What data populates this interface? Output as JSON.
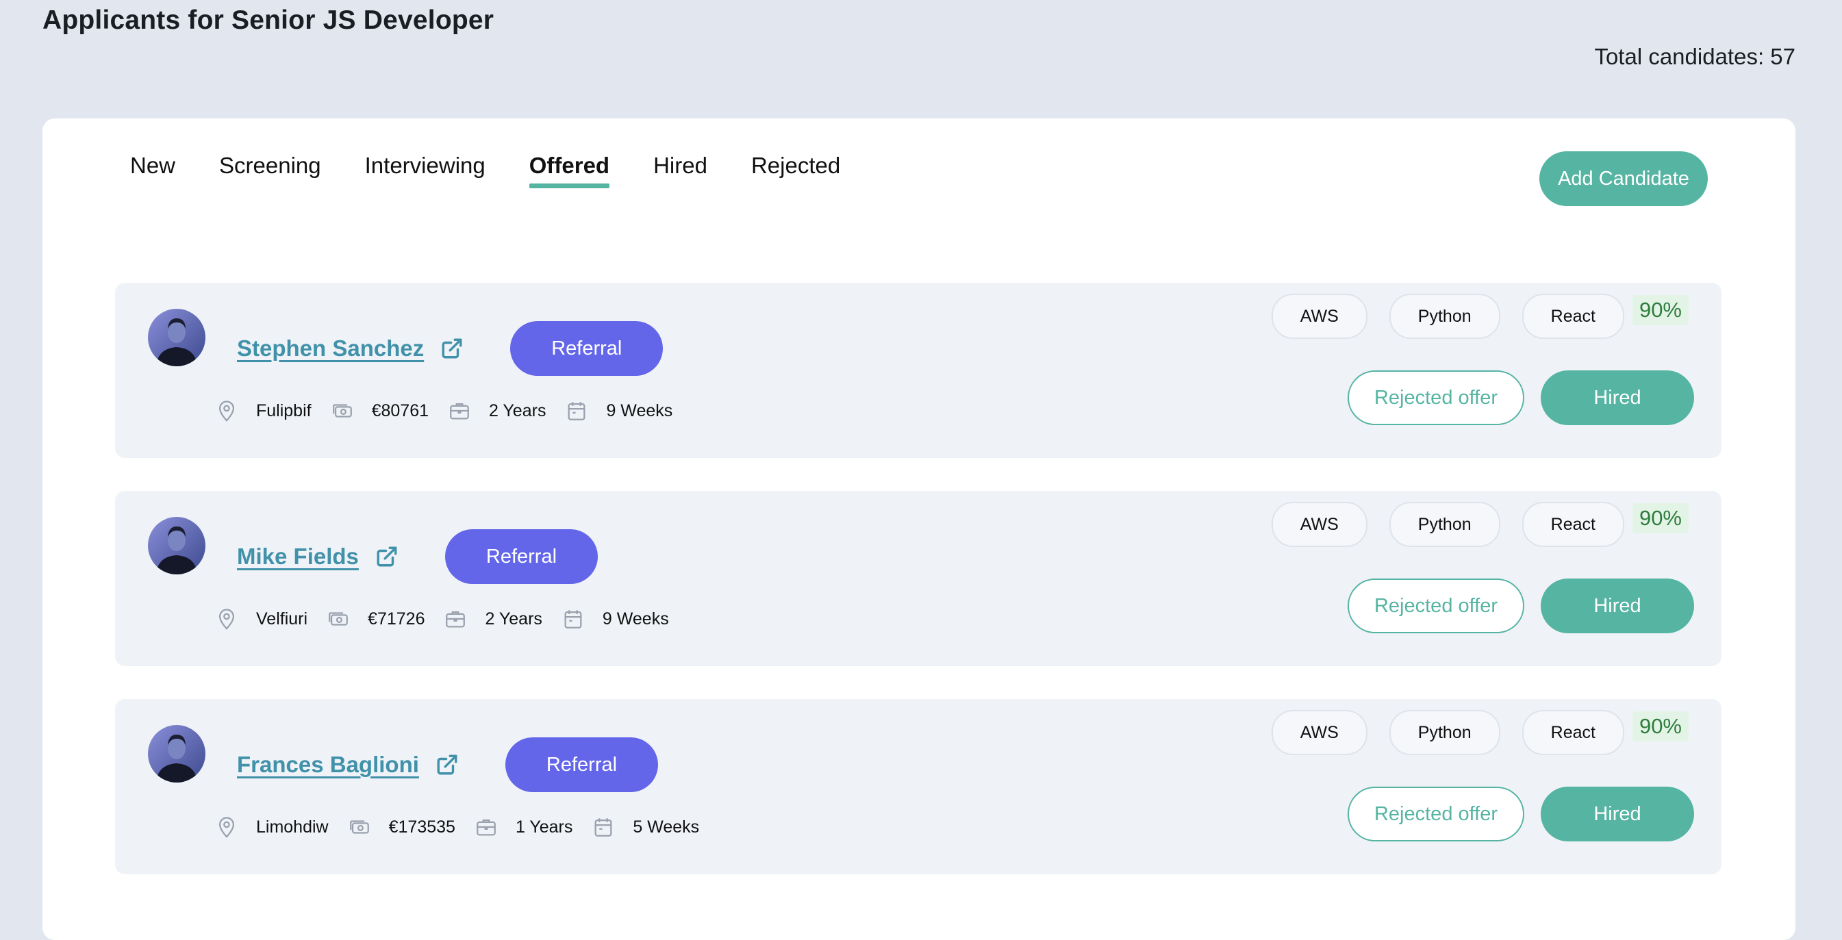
{
  "header": {
    "title": "Applicants for Senior JS Developer",
    "total_label": "Total candidates: 57"
  },
  "tabs": [
    {
      "label": "New",
      "active": false
    },
    {
      "label": "Screening",
      "active": false
    },
    {
      "label": "Interviewing",
      "active": false
    },
    {
      "label": "Offered",
      "active": true
    },
    {
      "label": "Hired",
      "active": false
    },
    {
      "label": "Rejected",
      "active": false
    }
  ],
  "add_button_label": "Add Candidate",
  "colors": {
    "accent": "#55b4a2",
    "referral": "#6466ea",
    "link": "#4091a9",
    "score_bg": "#e3f4e6",
    "score_text": "#2f7d3e"
  },
  "candidates": [
    {
      "name": "Stephen Sanchez",
      "badge": "Referral",
      "location": "Fulipbif",
      "salary": "€80761",
      "experience": "2 Years",
      "notice": "9 Weeks",
      "skills": [
        "AWS",
        "Python",
        "React"
      ],
      "score": "90%",
      "reject_label": "Rejected offer",
      "hire_label": "Hired"
    },
    {
      "name": "Mike Fields",
      "badge": "Referral",
      "location": "Velfiuri",
      "salary": "€71726",
      "experience": "2 Years",
      "notice": "9 Weeks",
      "skills": [
        "AWS",
        "Python",
        "React"
      ],
      "score": "90%",
      "reject_label": "Rejected offer",
      "hire_label": "Hired"
    },
    {
      "name": "Frances Baglioni",
      "badge": "Referral",
      "location": "Limohdiw",
      "salary": "€173535",
      "experience": "1 Years",
      "notice": "5 Weeks",
      "skills": [
        "AWS",
        "Python",
        "React"
      ],
      "score": "90%",
      "reject_label": "Rejected offer",
      "hire_label": "Hired"
    }
  ],
  "icons": {
    "external": "external-link-icon",
    "location": "map-pin-icon",
    "salary": "money-icon",
    "experience": "briefcase-icon",
    "notice": "calendar-icon"
  }
}
